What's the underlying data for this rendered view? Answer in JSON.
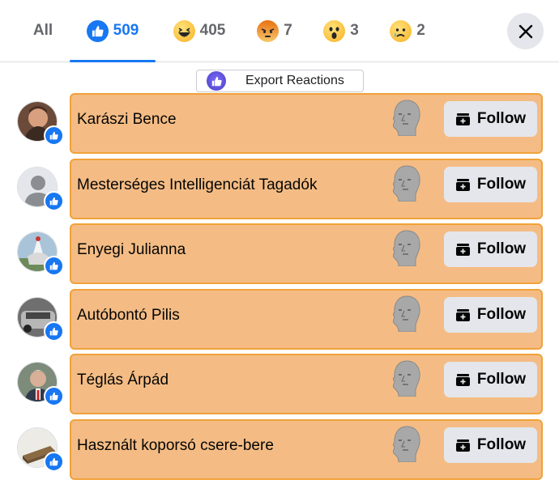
{
  "tabs": [
    {
      "label": "All"
    },
    {
      "label": "509",
      "icon": "like-icon",
      "active": true
    },
    {
      "label": "405",
      "icon": "haha-emoji-icon"
    },
    {
      "label": "7",
      "icon": "angry-emoji-icon"
    },
    {
      "label": "3",
      "icon": "wow-emoji-icon"
    },
    {
      "label": "2",
      "icon": "sad-emoji-icon"
    }
  ],
  "export_button": {
    "label": "Export Reactions"
  },
  "follow_label": "Follow",
  "people": [
    {
      "name": "Karászi Bence"
    },
    {
      "name": "Mesterséges Intelligenciát Tagadók"
    },
    {
      "name": "Enyegi Julianna"
    },
    {
      "name": "Autóbontó Pilis"
    },
    {
      "name": "Téglás Árpád"
    },
    {
      "name": "Használt koporsó csere-bere"
    }
  ],
  "colors": {
    "accent": "#1877f2",
    "card_fill": "#f4bc84",
    "card_border": "#f0a23a"
  }
}
